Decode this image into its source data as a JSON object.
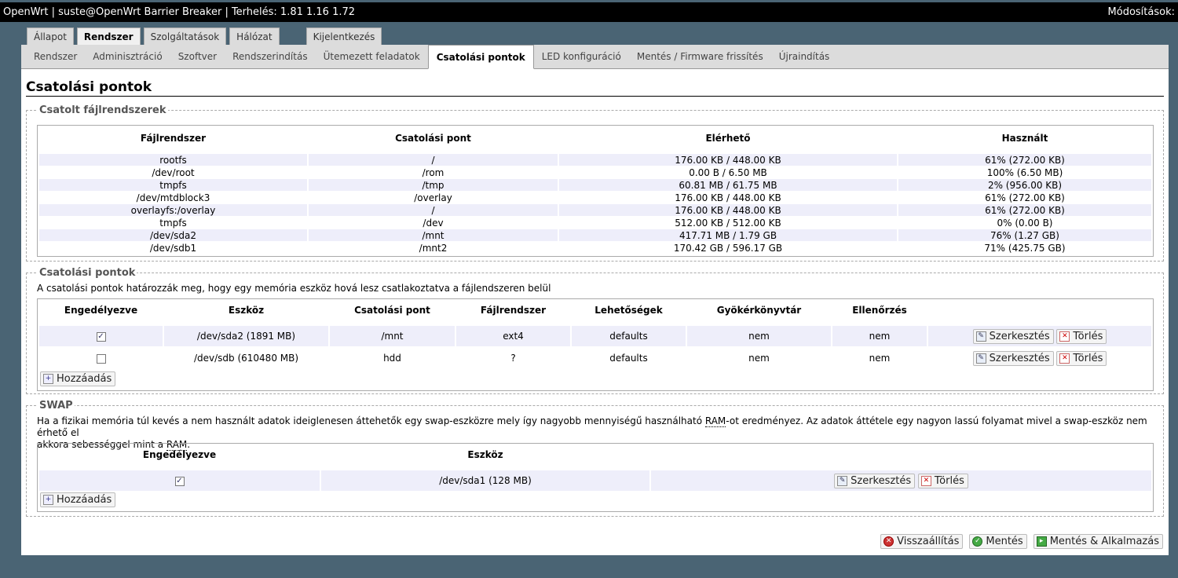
{
  "header": {
    "title": "OpenWrt | suste@OpenWrt Barrier Breaker | Terhelés: 1.81 1.16 1.72",
    "changes": "Módosítások:"
  },
  "main_tabs": [
    "Állapot",
    "Rendszer",
    "Szolgáltatások",
    "Hálózat",
    "Kijelentkezés"
  ],
  "sub_tabs": [
    "Rendszer",
    "Adminisztráció",
    "Szoftver",
    "Rendszerindítás",
    "Ütemezett feladatok",
    "Csatolási pontok",
    "LED konfiguráció",
    "Mentés / Firmware frissítés",
    "Újraindítás"
  ],
  "page_title": "Csatolási pontok",
  "mounted": {
    "legend": "Csatolt fájlrendszerek",
    "headers": [
      "Fájlrendszer",
      "Csatolási pont",
      "Elérhető",
      "Használt"
    ],
    "rows": [
      [
        "rootfs",
        "/",
        "176.00 KB / 448.00 KB",
        "61% (272.00 KB)"
      ],
      [
        "/dev/root",
        "/rom",
        "0.00 B / 6.50 MB",
        "100% (6.50 MB)"
      ],
      [
        "tmpfs",
        "/tmp",
        "60.81 MB / 61.75 MB",
        "2% (956.00 KB)"
      ],
      [
        "/dev/mtdblock3",
        "/overlay",
        "176.00 KB / 448.00 KB",
        "61% (272.00 KB)"
      ],
      [
        "overlayfs:/overlay",
        "/",
        "176.00 KB / 448.00 KB",
        "61% (272.00 KB)"
      ],
      [
        "tmpfs",
        "/dev",
        "512.00 KB / 512.00 KB",
        "0% (0.00 B)"
      ],
      [
        "/dev/sda2",
        "/mnt",
        "417.71 MB / 1.79 GB",
        "76% (1.27 GB)"
      ],
      [
        "/dev/sdb1",
        "/mnt2",
        "170.42 GB / 596.17 GB",
        "71% (425.75 GB)"
      ]
    ]
  },
  "mountpoints": {
    "legend": "Csatolási pontok",
    "description": "A csatolási pontok határozzák meg, hogy egy memória eszköz hová lesz csatlakoztatva a fájlendszeren belül",
    "headers": [
      "Engedélyezve",
      "Eszköz",
      "Csatolási pont",
      "Fájlrendszer",
      "Lehetőségek",
      "Gyökérkönyvtár",
      "Ellenőrzés"
    ],
    "rows": [
      {
        "enabled": true,
        "device": "/dev/sda2 (1891 MB)",
        "mount": "/mnt",
        "fs": "ext4",
        "options": "defaults",
        "root": "nem",
        "check": "nem"
      },
      {
        "enabled": false,
        "device": "/dev/sdb (610480 MB)",
        "mount": "hdd",
        "fs": "?",
        "options": "defaults",
        "root": "nem",
        "check": "nem"
      }
    ],
    "edit_label": "Szerkesztés",
    "delete_label": "Törlés",
    "add_label": "Hozzáadás"
  },
  "swap": {
    "legend": "SWAP",
    "desc_part1": "Ha a fizikai memória túl kevés a nem használt adatok ideiglenesen áttehetők egy swap-eszközre mely így nagyobb mennyiségű használható ",
    "ram": "RAM",
    "desc_part2": "-ot eredményez. Az adatok áttétele egy nagyon lassú folyamat mivel a swap-eszköz nem érhető el",
    "desc_part3": "akkora sebességgel mint a ",
    "desc_end": ".",
    "headers": [
      "Engedélyezve",
      "Eszköz"
    ],
    "rows": [
      {
        "enabled": true,
        "device": "/dev/sda1 (128 MB)"
      }
    ],
    "edit_label": "Szerkesztés",
    "delete_label": "Törlés",
    "add_label": "Hozzáadás"
  },
  "footer": {
    "reset_label": "Visszaállítás",
    "save_label": "Mentés",
    "apply_label": "Mentés & Alkalmazás"
  }
}
